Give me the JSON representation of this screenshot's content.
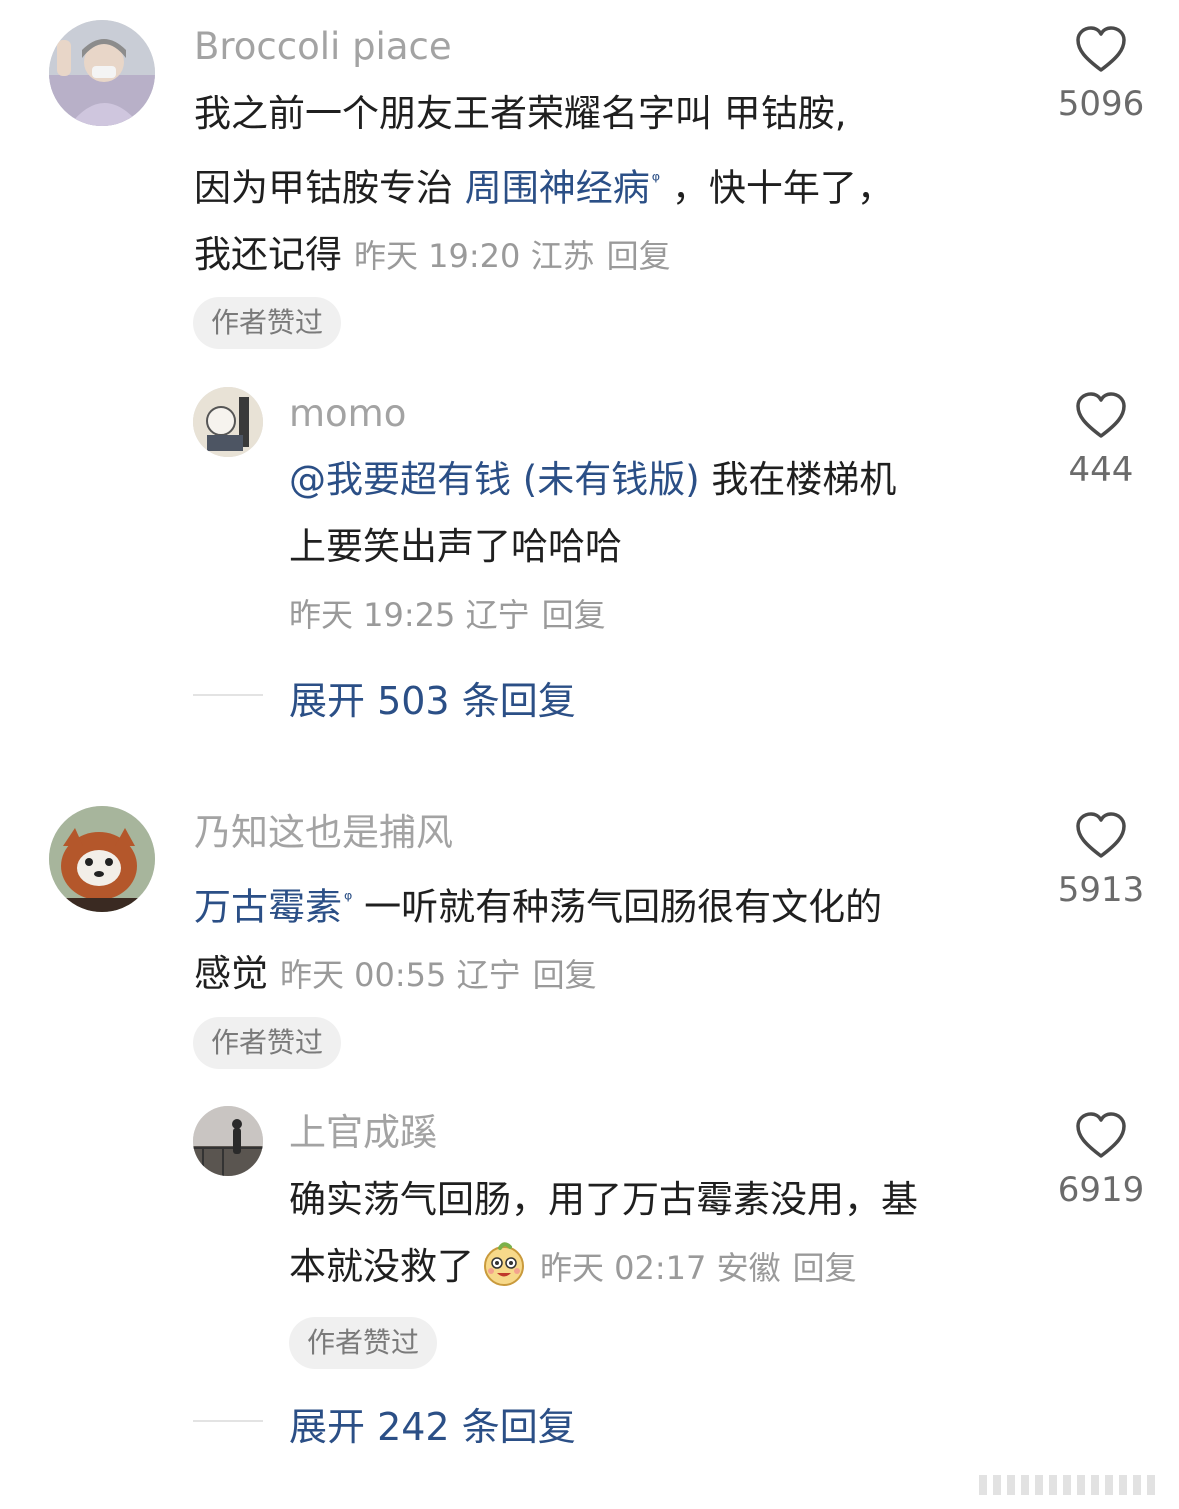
{
  "comments": [
    {
      "username": "Broccoli piace",
      "text_a": "我之前一个朋友王者荣耀名字叫 甲钴胺,",
      "text_b": "因为甲钴胺专治 ",
      "link": "周围神经病",
      "text_c": " ，快十年了，",
      "text_d": "我还记得",
      "time": "昨天 19:20 江苏",
      "reply": "回复",
      "likes": "5096",
      "badge": "作者赞过",
      "replies": [
        {
          "username": "momo",
          "mention": "@我要超有钱 (未有钱版)",
          "text_a": " 我在楼梯机",
          "text_b": "上要笑出声了哈哈哈",
          "time": "昨天 19:25 辽宁",
          "reply": "回复",
          "likes": "444"
        }
      ],
      "expand": "展开 503 条回复"
    },
    {
      "username": "乃知这也是捕风",
      "link": "万古霉素",
      "text_a": " 一听就有种荡气回肠很有文化的",
      "text_b": "感觉",
      "time": "昨天 00:55 辽宁",
      "reply": "回复",
      "likes": "5913",
      "badge": "作者赞过",
      "replies": [
        {
          "username": "上官成蹊",
          "text_a": "确实荡气回肠，用了万古霉素没用，基",
          "text_b": "本就没救了",
          "time": "昨天 02:17 安徽",
          "reply": "回复",
          "likes": "6919",
          "badge": "作者赞过"
        }
      ],
      "expand": "展开 242 条回复"
    }
  ]
}
